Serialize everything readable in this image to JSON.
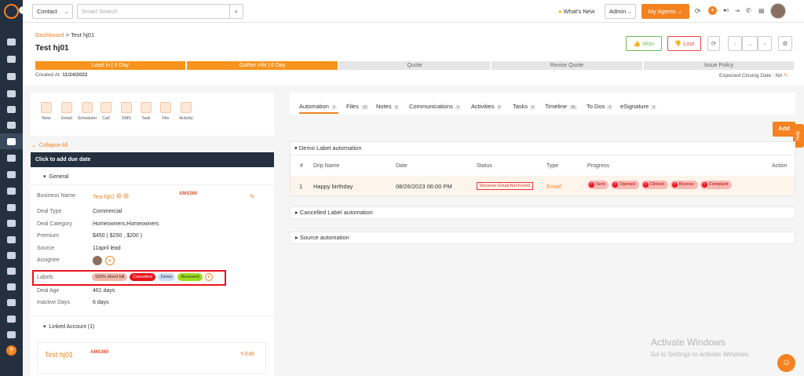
{
  "topbar": {
    "module_select": "Contact",
    "search_placeholder": "Smart Search",
    "whats_new": "What's New",
    "user_role": "Admin",
    "my_agents": "My Agents",
    "notif_count": "0"
  },
  "breadcrumb": {
    "root": "Dashboard",
    "sep": " > ",
    "current": "Test hj01"
  },
  "page_title": "Test hj01",
  "actions": {
    "won": "Won",
    "lost": "Lost",
    "more": "..."
  },
  "stages": [
    "Lead in | 0 Day",
    "Gather info | 6 Day",
    "Quote",
    "Revise Quote",
    "Issue Policy"
  ],
  "created_label": "Created At:",
  "created_value": "11/24/2022",
  "closing": "Expected Closing Date : NA",
  "quick_actions": [
    "Note",
    "Email",
    "Scheduler",
    "Call",
    "SMS",
    "Task",
    "File",
    "Activity"
  ],
  "collapse_all": "Collapse All",
  "due_date": "Click to add due date",
  "general": "General",
  "fields": {
    "business_name_label": "Business Name",
    "business_name": "Test hj01",
    "brand": "AMS360",
    "deal_type_label": "Deal Type",
    "deal_type": "Commercial",
    "deal_category_label": "Deal Category",
    "deal_category": "Homeowners,Homeowners",
    "premium_label": "Premium",
    "premium": "$450 ( $250 , $200 )",
    "source_label": "Source",
    "source": "11april lead",
    "assignee_label": "Assignee",
    "labels_label": "Labels",
    "deal_age_label": "Deal Age",
    "deal_age": "461 days",
    "inactive_label": "Inactive Days",
    "inactive": "6 days"
  },
  "labels": [
    {
      "text": "100% direct bill",
      "bg": "#f4b8a8",
      "fg": "#333"
    },
    {
      "text": "Cancelled",
      "bg": "#e8131c",
      "fg": "#fff"
    },
    {
      "text": "Demo",
      "bg": "#c9dcf7",
      "fg": "#333"
    },
    {
      "text": "Renewed",
      "bg": "#9bdc1e",
      "fg": "#333"
    }
  ],
  "linked": {
    "title": "Linked Account (1)",
    "name": "Test hj01",
    "brand": "AMS360",
    "edit": "Edit"
  },
  "tabs": [
    {
      "label": "Automation",
      "count": "3"
    },
    {
      "label": "Files",
      "count": "10"
    },
    {
      "label": "Notes",
      "count": "0"
    },
    {
      "label": "Communications",
      "count": "0"
    },
    {
      "label": "Activities",
      "count": "0"
    },
    {
      "label": "Tasks",
      "count": "0"
    },
    {
      "label": "Timeline",
      "count": "36"
    },
    {
      "label": "To Dos",
      "count": "0"
    },
    {
      "label": "eSignature",
      "count": "0"
    }
  ],
  "add_btn": "Add",
  "help": "Help",
  "automations": {
    "demo": "Demo Label automation",
    "cancelled": "Cancelled Label automation",
    "source": "Source automation",
    "columns": [
      "#",
      "Drip Name",
      "Date",
      "Status",
      "Type",
      "Progress",
      "Action"
    ],
    "row": {
      "num": "1",
      "name": "Happy birthday",
      "date": "08/26/2023 06:00 PM",
      "status": "Reciever Email Not Found",
      "type": "Email",
      "progress": [
        "Sent",
        "Opened",
        "Clicked",
        "Bounce",
        "Complaint"
      ]
    }
  },
  "watermark": {
    "line1": "Activate Windows",
    "line2": "Go to Settings to activate Windows."
  },
  "colors": {
    "accent": "#f58220",
    "sidebar": "#243040",
    "stage_active": "#f7941d",
    "stage_inactive": "#e6e6e6",
    "highlight": "#e8131c"
  }
}
